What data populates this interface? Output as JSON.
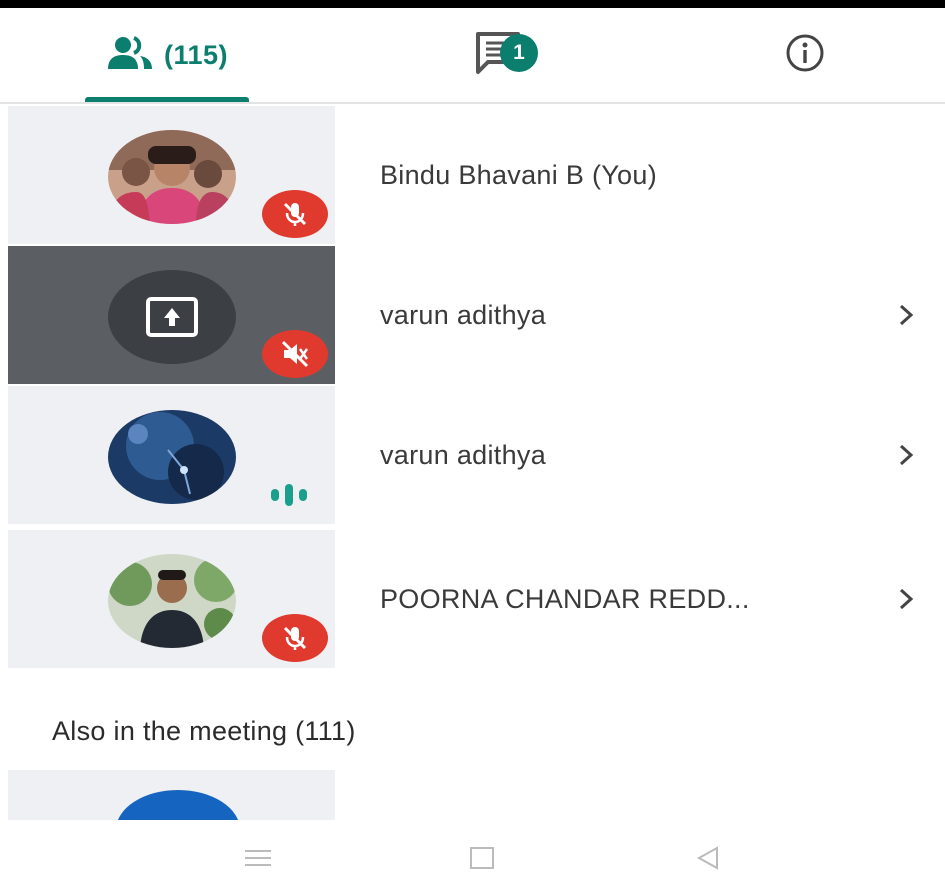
{
  "tabs": {
    "participants_count": "(115)",
    "chat_badge": "1"
  },
  "participants": [
    {
      "name": "Bindu Bhavani B (You)",
      "status": "muted",
      "avatar": "photo-group-icon"
    },
    {
      "name": "varun adithya",
      "status": "muted",
      "avatar": "screen-share-icon"
    },
    {
      "name": "varun adithya",
      "status": "speaking",
      "avatar": "photo-abstract-icon"
    },
    {
      "name": "POORNA CHANDAR REDD...",
      "status": "muted",
      "avatar": "photo-man-icon"
    }
  ],
  "section": {
    "also_in_meeting": "Also in the meeting (111)"
  },
  "colors": {
    "accent": "#0b7e6e",
    "mute": "#e03a2f",
    "active_tile": "#5b5f63",
    "tile": "#eef0f3"
  },
  "icons": {
    "people_tab": "people-icon",
    "chat_tab": "chat-icon",
    "info_tab": "info-icon",
    "row_action": "chevron-right-icon"
  }
}
